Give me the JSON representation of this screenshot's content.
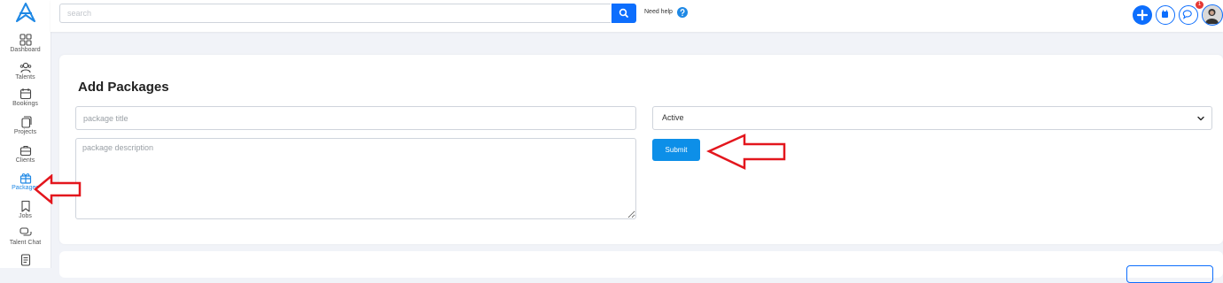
{
  "sidebar": {
    "items": [
      {
        "label": "Dashboard",
        "icon": "grid-icon"
      },
      {
        "label": "Talents",
        "icon": "users-icon"
      },
      {
        "label": "Bookings",
        "icon": "calendar-icon"
      },
      {
        "label": "Projects",
        "icon": "copy-icon"
      },
      {
        "label": "Clients",
        "icon": "briefcase-icon"
      },
      {
        "label": "Packages",
        "icon": "gift-icon",
        "active": true
      },
      {
        "label": "Jobs",
        "icon": "bookmark-icon"
      },
      {
        "label": "Talent Chat",
        "icon": "chat-bubbles-icon"
      },
      {
        "label": "",
        "icon": "document-icon"
      }
    ]
  },
  "topbar": {
    "search_placeholder": "search",
    "need_help": "Need help",
    "notification_count": "1"
  },
  "form": {
    "title": "Add Packages",
    "title_placeholder": "package title",
    "description_placeholder": "package description",
    "status_value": "Active",
    "submit_label": "Submit"
  },
  "colors": {
    "primary": "#0d6efd",
    "submit": "#0d8fe8",
    "annotation_arrow": "#e3161d",
    "badge": "#e53935"
  }
}
